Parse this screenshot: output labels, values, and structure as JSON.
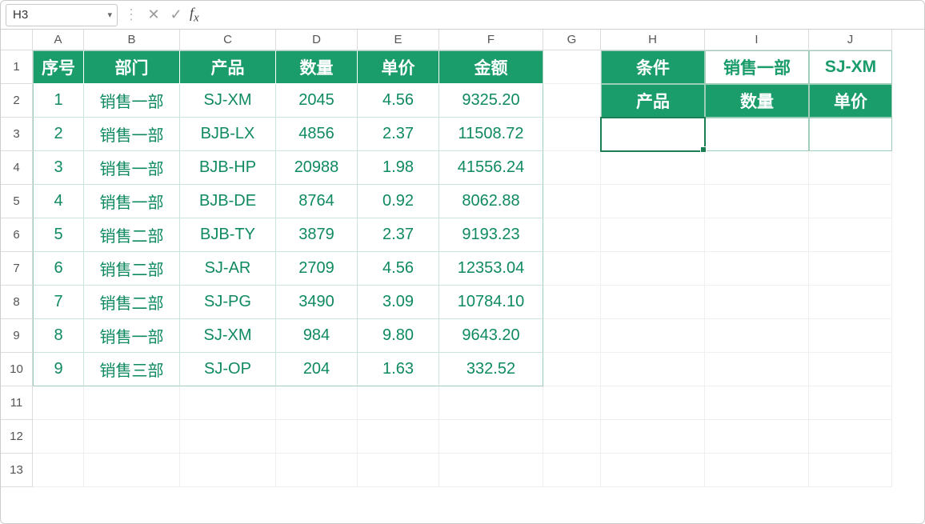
{
  "formula_bar": {
    "cell_ref": "H3",
    "formula": ""
  },
  "columns": [
    "A",
    "B",
    "C",
    "D",
    "E",
    "F",
    "G",
    "H",
    "I",
    "J"
  ],
  "row_headers": [
    "1",
    "2",
    "3",
    "4",
    "5",
    "6",
    "7",
    "8",
    "9",
    "10",
    "11",
    "12",
    "13"
  ],
  "main_table": {
    "headers": [
      "序号",
      "部门",
      "产品",
      "数量",
      "单价",
      "金额"
    ],
    "rows": [
      {
        "n": "1",
        "dept": "销售一部",
        "prod": "SJ-XM",
        "qty": "2045",
        "price": "4.56",
        "amt": "9325.20"
      },
      {
        "n": "2",
        "dept": "销售一部",
        "prod": "BJB-LX",
        "qty": "4856",
        "price": "2.37",
        "amt": "11508.72"
      },
      {
        "n": "3",
        "dept": "销售一部",
        "prod": "BJB-HP",
        "qty": "20988",
        "price": "1.98",
        "amt": "41556.24"
      },
      {
        "n": "4",
        "dept": "销售一部",
        "prod": "BJB-DE",
        "qty": "8764",
        "price": "0.92",
        "amt": "8062.88"
      },
      {
        "n": "5",
        "dept": "销售二部",
        "prod": "BJB-TY",
        "qty": "3879",
        "price": "2.37",
        "amt": "9193.23"
      },
      {
        "n": "6",
        "dept": "销售二部",
        "prod": "SJ-AR",
        "qty": "2709",
        "price": "4.56",
        "amt": "12353.04"
      },
      {
        "n": "7",
        "dept": "销售二部",
        "prod": "SJ-PG",
        "qty": "3490",
        "price": "3.09",
        "amt": "10784.10"
      },
      {
        "n": "8",
        "dept": "销售一部",
        "prod": "SJ-XM",
        "qty": "984",
        "price": "9.80",
        "amt": "9643.20"
      },
      {
        "n": "9",
        "dept": "销售三部",
        "prod": "SJ-OP",
        "qty": "204",
        "price": "1.63",
        "amt": "332.52"
      }
    ]
  },
  "side_table": {
    "row1": {
      "label": "条件",
      "v1": "销售一部",
      "v2": "SJ-XM"
    },
    "row2": {
      "label": "产品",
      "v1": "数量",
      "v2": "单价"
    },
    "row3": {
      "c1": "",
      "c2": "",
      "c3": ""
    }
  }
}
